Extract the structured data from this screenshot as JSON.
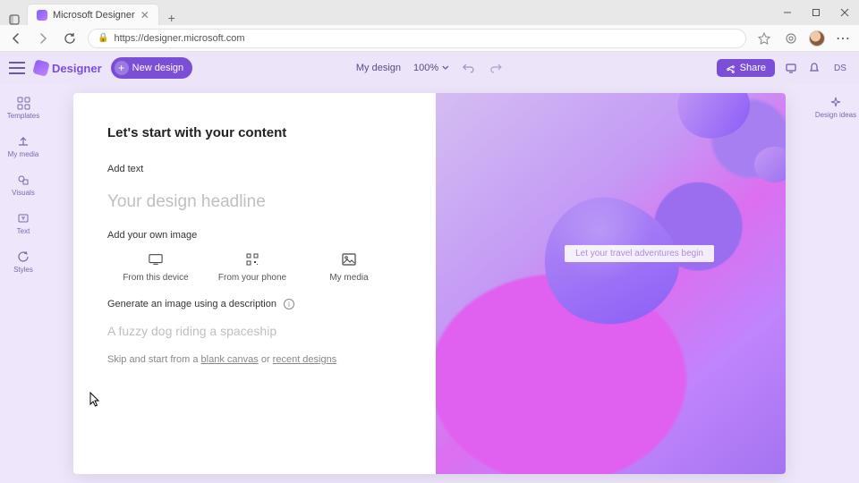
{
  "browser": {
    "tab_title": "Microsoft Designer",
    "url": "https://designer.microsoft.com"
  },
  "toolbar": {
    "app_name": "Designer",
    "new_design": "New design",
    "doc_title": "My design",
    "zoom": "100%",
    "share": "Share",
    "user_initials": "DS"
  },
  "rails": {
    "left": [
      {
        "label": "Templates"
      },
      {
        "label": "My media"
      },
      {
        "label": "Visuals"
      },
      {
        "label": "Text"
      },
      {
        "label": "Styles"
      }
    ],
    "right": [
      {
        "label": "Design ideas"
      }
    ]
  },
  "modal": {
    "title": "Let's start with your content",
    "add_text_label": "Add text",
    "headline_placeholder": "Your design headline",
    "add_image_label": "Add your own image",
    "image_options": {
      "device": "From this device",
      "phone": "From your phone",
      "media": "My media"
    },
    "generate_label": "Generate an image using a description",
    "generate_placeholder": "A fuzzy dog riding a spaceship",
    "skip_prefix": "Skip and start from a ",
    "skip_blank": "blank canvas",
    "skip_or": " or ",
    "skip_recent": "recent designs",
    "preview_text": "Let your travel adventures begin"
  }
}
